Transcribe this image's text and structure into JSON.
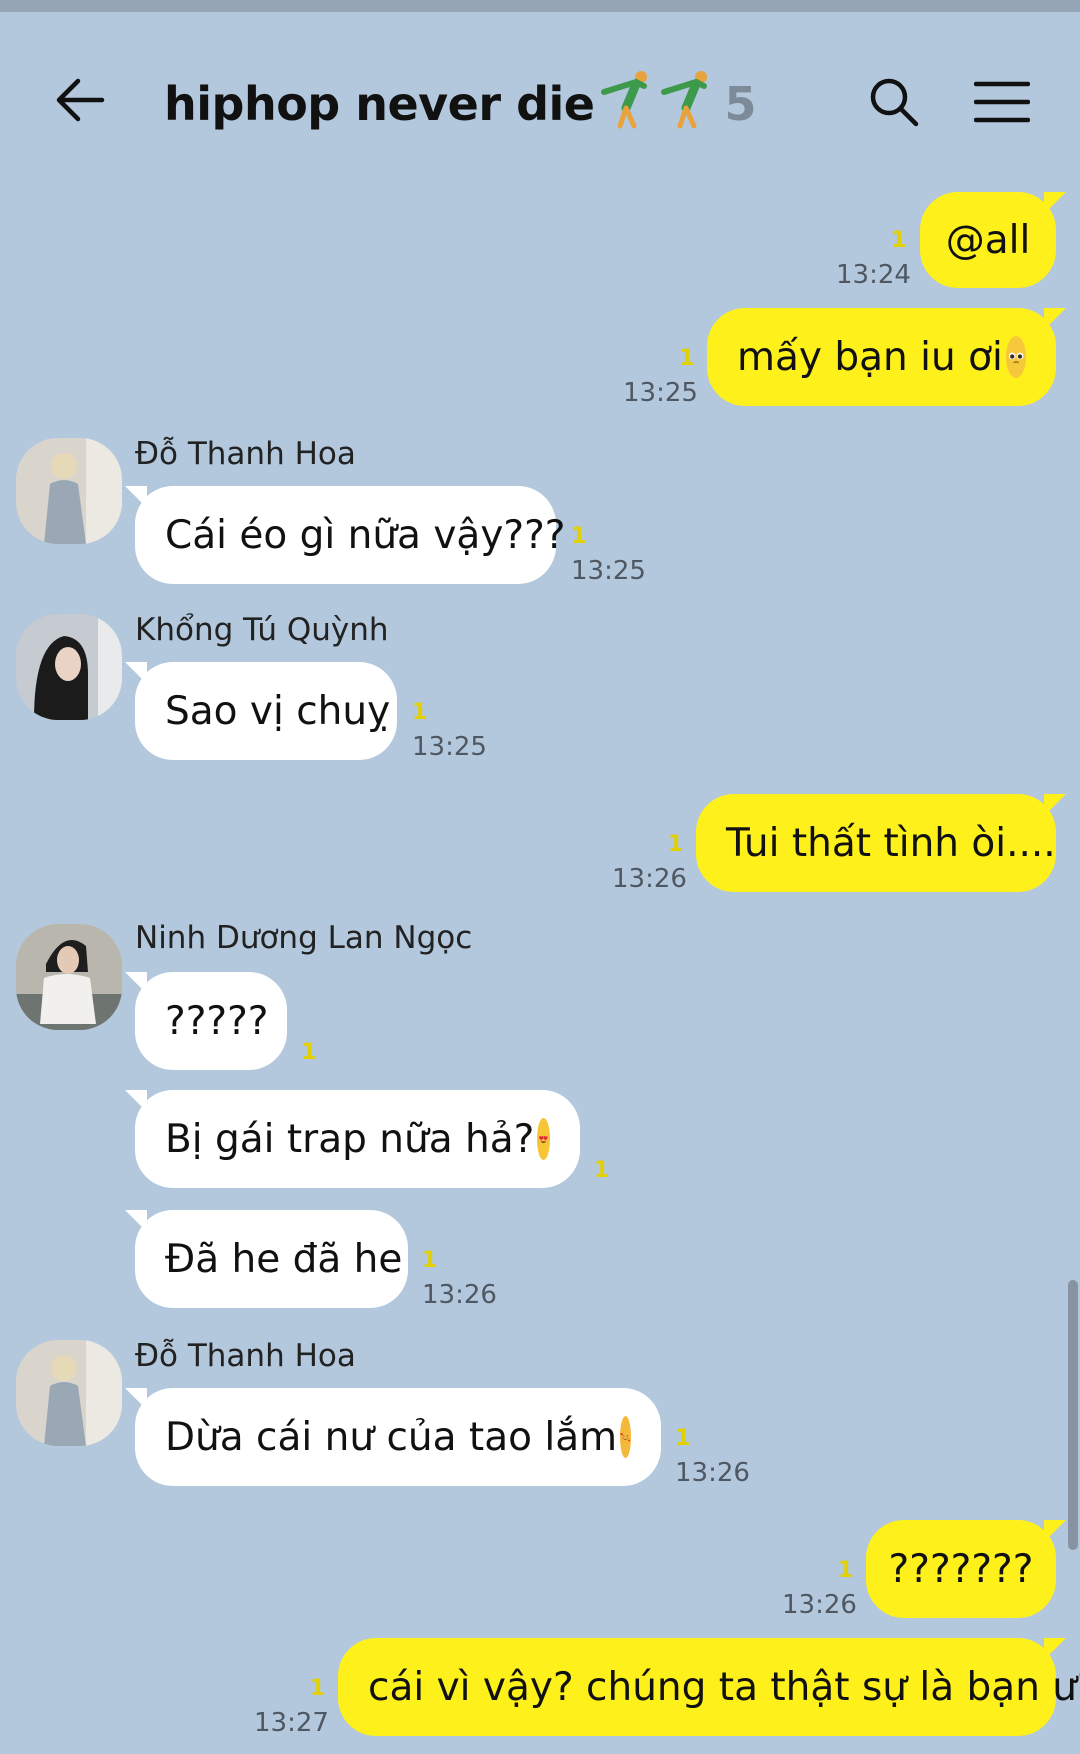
{
  "header": {
    "title": "hiphop never die",
    "member_count": "5",
    "back_icon": "back-arrow-icon",
    "search_icon": "search-icon",
    "menu_icon": "hamburger-menu-icon"
  },
  "messages": [
    {
      "sender": "me",
      "text": "@all",
      "unread": "1",
      "time": "13:24"
    },
    {
      "sender": "me",
      "text": "mấy bạn iu ơi",
      "emoji": "pleading-face",
      "unread": "1",
      "time": "13:25"
    },
    {
      "sender": "Đỗ Thanh Hoa",
      "text": "Cái éo gì nữa vậy???",
      "unread": "1",
      "time": "13:25"
    },
    {
      "sender": "Khổng Tú Quỳnh",
      "text": "Sao vị chuỵ",
      "unread": "1",
      "time": "13:25"
    },
    {
      "sender": "me",
      "text": "Tui thất tình òi....",
      "unread": "1",
      "time": "13:26"
    },
    {
      "sender": "Ninh Dương Lan Ngọc",
      "text": "?????",
      "unread": "1"
    },
    {
      "sender": "Ninh Dương Lan Ngọc",
      "text": "Bị gái trap nữa hả?",
      "emoji": "heart-eyes",
      "unread": "1"
    },
    {
      "sender": "Ninh Dương Lan Ngọc",
      "text": "Đã he đã he",
      "unread": "1",
      "time": "13:26"
    },
    {
      "sender": "Đỗ Thanh Hoa",
      "text": "Dừa cái nư của tao lắm",
      "emoji": "smiling-face-with-hearts",
      "unread": "1",
      "time": "13:26"
    },
    {
      "sender": "me",
      "text": "???????",
      "unread": "1",
      "time": "13:26"
    },
    {
      "sender": "me",
      "text": "cái vì vậy? chúng ta thật sự là bạn ư?",
      "unread": "1",
      "time": "13:27"
    }
  ],
  "colors": {
    "background": "#b3c8dd",
    "my_bubble": "#fef01b",
    "their_bubble": "#ffffff",
    "unread": "#e2d000"
  }
}
